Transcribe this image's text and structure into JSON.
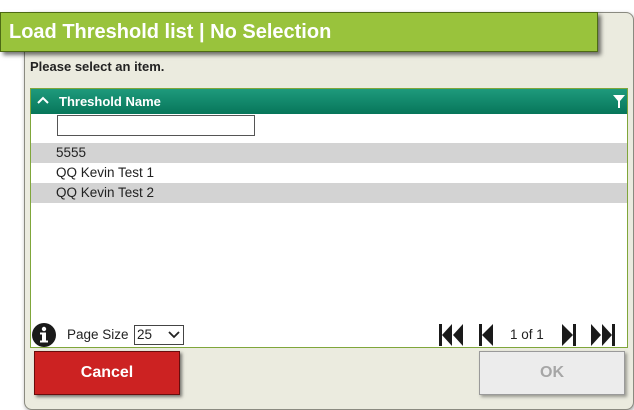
{
  "dialog": {
    "title": "Load Threshold list | No Selection",
    "instruction": "Please select an item."
  },
  "grid": {
    "column_header": "Threshold Name",
    "filter_value": "",
    "rows": [
      "5555",
      "QQ Kevin Test 1",
      "QQ Kevin Test 2"
    ]
  },
  "pager": {
    "page_size_label": "Page Size",
    "page_size_value": "25",
    "page_info": "1 of 1"
  },
  "buttons": {
    "cancel": "Cancel",
    "ok": "OK"
  },
  "icons": {
    "sort": "chevron-up-icon",
    "filter": "filter-icon",
    "info": "info-icon",
    "first": "first-page-icon",
    "prev": "previous-page-icon",
    "next": "next-page-icon",
    "last": "last-page-icon"
  },
  "colors": {
    "title_bar": "#99c33c",
    "grid_header": "#07765a",
    "alt_row": "#d3d3d3",
    "cancel": "#cc2222",
    "ok_disabled": "#ececec"
  }
}
